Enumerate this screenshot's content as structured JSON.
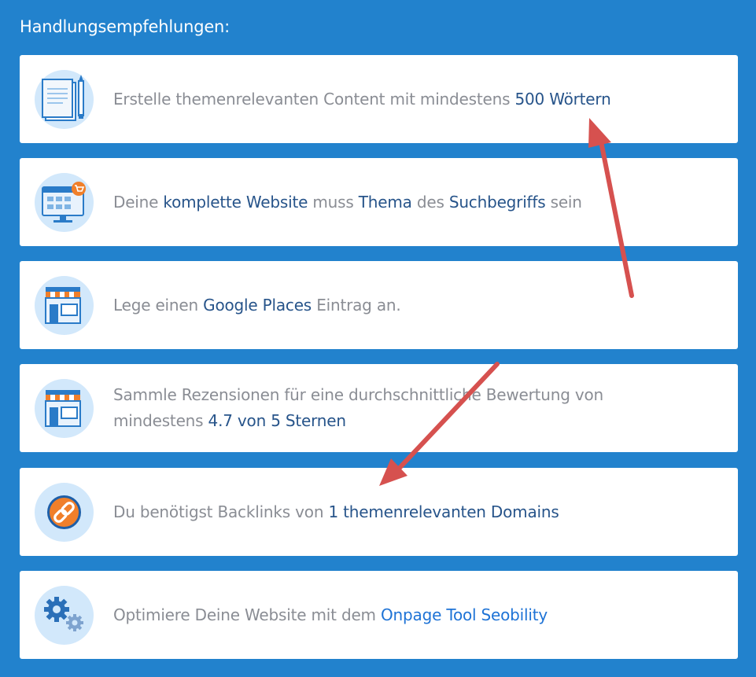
{
  "heading": "Handlungsempfehlungen:",
  "colors": {
    "background": "#2282cd",
    "card": "#ffffff",
    "icon_circle": "#d2e8fb",
    "text": "#8a8d94",
    "highlight": "#27548a",
    "link": "#1e73d6",
    "arrow": "#d6514f"
  },
  "recommendations": [
    {
      "icon": "document-pencil-icon",
      "segments": [
        {
          "text": "Erstelle themenrelevanten Content mit mindestens ",
          "style": "normal"
        },
        {
          "text": "500 Wörtern",
          "style": "highlight"
        }
      ]
    },
    {
      "icon": "website-shop-icon",
      "segments": [
        {
          "text": "Deine ",
          "style": "normal"
        },
        {
          "text": "komplette Website",
          "style": "highlight"
        },
        {
          "text": " muss ",
          "style": "normal"
        },
        {
          "text": "Thema",
          "style": "highlight"
        },
        {
          "text": " des ",
          "style": "normal"
        },
        {
          "text": "Suchbegriffs",
          "style": "highlight"
        },
        {
          "text": " sein",
          "style": "normal"
        }
      ]
    },
    {
      "icon": "storefront-icon",
      "segments": [
        {
          "text": "Lege einen ",
          "style": "normal"
        },
        {
          "text": "Google Places",
          "style": "highlight"
        },
        {
          "text": " Eintrag an.",
          "style": "normal"
        }
      ]
    },
    {
      "icon": "storefront-icon",
      "segments": [
        {
          "text": "Sammle Rezensionen für eine durchschnittliche Bewertung von mindestens ",
          "style": "normal"
        },
        {
          "text": "4.7 von 5 Sternen",
          "style": "highlight"
        }
      ]
    },
    {
      "icon": "link-icon",
      "segments": [
        {
          "text": "Du benötigst Backlinks von ",
          "style": "normal"
        },
        {
          "text": "1 themenrelevanten Domains",
          "style": "highlight"
        }
      ]
    },
    {
      "icon": "gears-icon",
      "segments": [
        {
          "text": "Optimiere Deine Website mit dem ",
          "style": "normal"
        },
        {
          "text": "Onpage Tool Seobility",
          "style": "link"
        }
      ]
    }
  ]
}
